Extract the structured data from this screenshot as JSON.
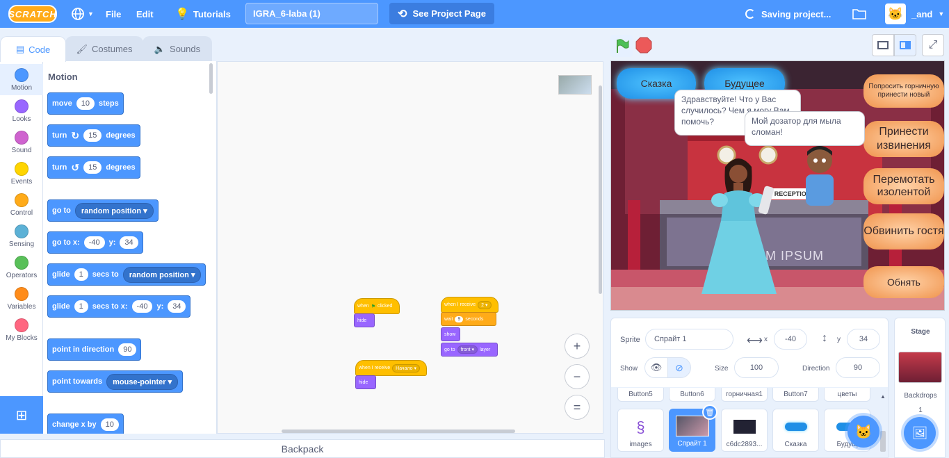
{
  "menu": {
    "logo": "SCRATCH",
    "file": "File",
    "edit": "Edit",
    "tutorials": "Tutorials",
    "project_title": "IGRA_6-laba (1)",
    "see_project": "See Project Page",
    "saving": "Saving project...",
    "username": "_and"
  },
  "tabs": {
    "code": "Code",
    "costumes": "Costumes",
    "sounds": "Sounds"
  },
  "categories": [
    {
      "label": "Motion",
      "color": "#4c97ff"
    },
    {
      "label": "Looks",
      "color": "#9966ff"
    },
    {
      "label": "Sound",
      "color": "#cf63cf"
    },
    {
      "label": "Events",
      "color": "#ffd500"
    },
    {
      "label": "Control",
      "color": "#ffab19"
    },
    {
      "label": "Sensing",
      "color": "#5cb1d6"
    },
    {
      "label": "Operators",
      "color": "#59c059"
    },
    {
      "label": "Variables",
      "color": "#ff8c1a"
    },
    {
      "label": "My Blocks",
      "color": "#ff6680"
    }
  ],
  "palette": {
    "heading": "Motion",
    "move": {
      "a": "move",
      "n": "10",
      "b": "steps"
    },
    "turn_right": {
      "a": "turn",
      "n": "15",
      "b": "degrees"
    },
    "turn_left": {
      "a": "turn",
      "n": "15",
      "b": "degrees"
    },
    "goto": {
      "a": "go to",
      "d": "random position"
    },
    "goto_xy": {
      "a": "go to x:",
      "x": "-40",
      "b": "y:",
      "y": "34"
    },
    "glide": {
      "a": "glide",
      "n": "1",
      "b": "secs to",
      "d": "random position"
    },
    "glide_xy": {
      "a": "glide",
      "n": "1",
      "b": "secs to x:",
      "x": "-40",
      "c": "y:",
      "y": "34"
    },
    "point_dir": {
      "a": "point in direction",
      "n": "90"
    },
    "point_towards": {
      "a": "point towards",
      "d": "mouse-pointer"
    },
    "change_x": {
      "a": "change x by",
      "n": "10"
    }
  },
  "scripts": {
    "s1_hat": "when",
    "s1_hat2": "clicked",
    "s1_hide": "hide",
    "s2_hat": "when I receive",
    "s2_msg": "2",
    "s2_wait": "wait",
    "s2_wait_n": "9",
    "s2_seconds": "seconds",
    "s2_show": "show",
    "s2_goto": "go to",
    "s2_front": "front",
    "s2_layer": "layer",
    "s3_hat": "when I receive",
    "s3_msg": "Начало",
    "s3_hide": "hide"
  },
  "workspace": {
    "zoom_in": "+",
    "zoom_out": "−",
    "reset": "="
  },
  "backpack": "Backpack",
  "stage": {
    "btn_skazka": "Сказка",
    "btn_budushee": "Будущее",
    "btn_poprosit": "Попросить горничную принести новый",
    "btn_izvineniya": "Принести извинения",
    "btn_peremotat": "Перемотать изолентой",
    "btn_obvinit": "Обвинить гостя",
    "btn_obnyat": "Обнять",
    "bubble_admin": "Здравствуйте! Что у Вас случилось? Чем я могу Вам помочь?",
    "bubble_guest": "Мой дозатор для мыла сломан!",
    "reception": "RECEPTION",
    "ipsum": "M IPSUM"
  },
  "sprite_info": {
    "sprite_label": "Sprite",
    "sprite_name": "Спрайт 1",
    "x_label": "x",
    "x": "-40",
    "y_label": "y",
    "y": "34",
    "show_label": "Show",
    "size_label": "Size",
    "size": "100",
    "direction_label": "Direction",
    "direction": "90"
  },
  "sprite_names_row": [
    "Button5",
    "Button6",
    "горничная1",
    "Button7",
    "цветы"
  ],
  "sprite_tiles": [
    "images",
    "Спрайт 1",
    "c6dc2893...",
    "Сказка",
    "Будущ"
  ],
  "stage_pane": {
    "title": "Stage",
    "backdrops": "Backdrops",
    "count": "1"
  }
}
